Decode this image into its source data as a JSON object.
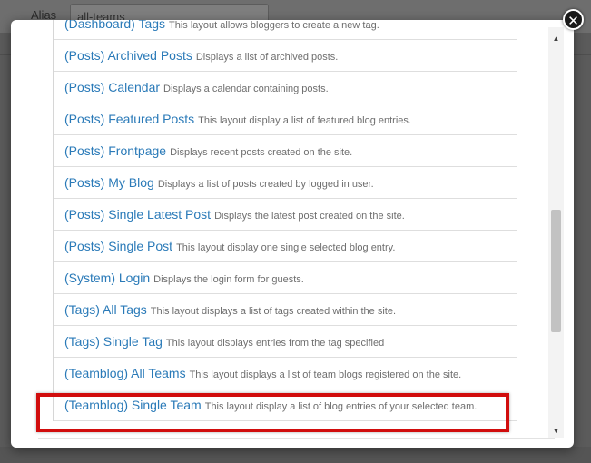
{
  "background": {
    "alias_label": "Alias",
    "alias_value": "all-teams"
  },
  "modal": {
    "close_symbol": "✕",
    "layouts": [
      {
        "name": "(Dashboard) Tags",
        "desc": "This layout allows bloggers to create a new tag."
      },
      {
        "name": "(Posts) Archived Posts",
        "desc": "Displays a list of archived posts."
      },
      {
        "name": "(Posts) Calendar",
        "desc": "Displays a calendar containing posts."
      },
      {
        "name": "(Posts) Featured Posts",
        "desc": "This layout display a list of featured blog entries."
      },
      {
        "name": "(Posts) Frontpage",
        "desc": "Displays recent posts created on the site."
      },
      {
        "name": "(Posts) My Blog",
        "desc": "Displays a list of posts created by logged in user."
      },
      {
        "name": "(Posts) Single Latest Post",
        "desc": "Displays the latest post created on the site."
      },
      {
        "name": "(Posts) Single Post",
        "desc": "This layout display one single selected blog entry."
      },
      {
        "name": "(System) Login",
        "desc": "Displays the login form for guests."
      },
      {
        "name": "(Tags) All Tags",
        "desc": "This layout displays a list of tags created within the site."
      },
      {
        "name": "(Tags) Single Tag",
        "desc": "This layout displays entries from the tag specified"
      },
      {
        "name": "(Teamblog) All Teams",
        "desc": "This layout displays a list of team blogs registered on the site."
      },
      {
        "name": "(Teamblog) Single Team",
        "desc": "This layout display a list of blog entries of your selected team."
      }
    ],
    "highlighted_index": 12,
    "highlight_color": "#d10d0d",
    "link_color": "#2a7ab8",
    "scrollbar": {
      "up_symbol": "▲",
      "down_symbol": "▼",
      "scroll_position_fraction": 0.55
    }
  }
}
